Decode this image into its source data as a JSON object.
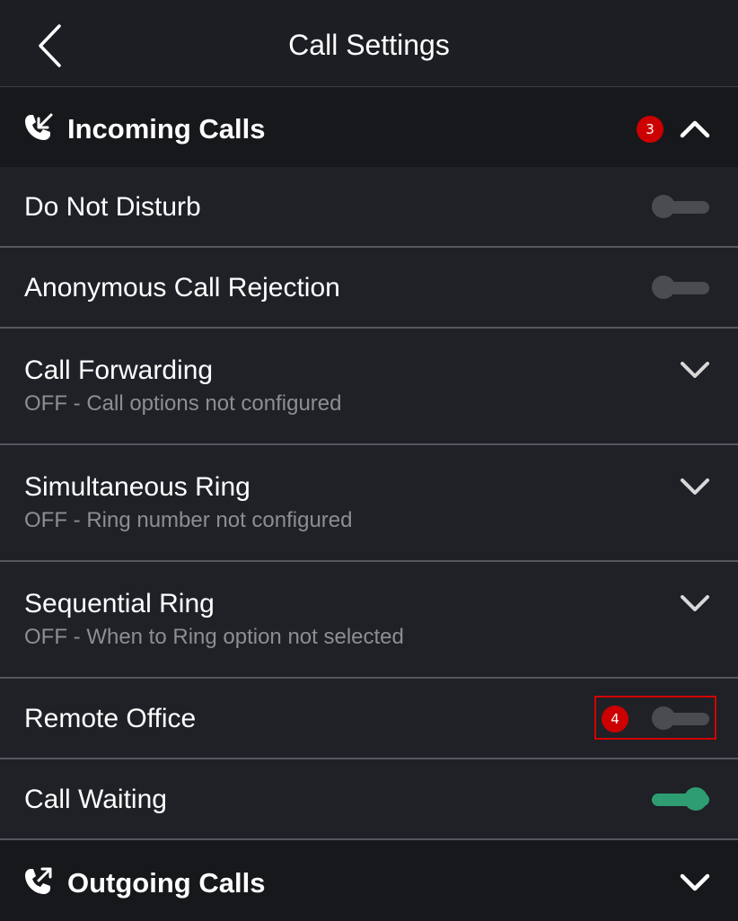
{
  "header": {
    "title": "Call Settings",
    "back_icon": "chevron-left-icon"
  },
  "incoming": {
    "title": "Incoming Calls",
    "icon": "incoming-call-icon",
    "badge": "3",
    "expanded": true
  },
  "rows": {
    "dnd": {
      "title": "Do Not Disturb",
      "toggle": false
    },
    "anon": {
      "title": "Anonymous Call Rejection",
      "toggle": false
    },
    "forwarding": {
      "title": "Call Forwarding",
      "subtitle": "OFF - Call options not configured"
    },
    "simring": {
      "title": "Simultaneous Ring",
      "subtitle": "OFF - Ring number not configured"
    },
    "seqring": {
      "title": "Sequential Ring",
      "subtitle": "OFF - When to Ring option not selected"
    },
    "remote": {
      "title": "Remote Office",
      "toggle": false,
      "badge": "4"
    },
    "waiting": {
      "title": "Call Waiting",
      "toggle": true
    }
  },
  "outgoing": {
    "title": "Outgoing Calls",
    "icon": "outgoing-call-icon",
    "expanded": false
  },
  "colors": {
    "background": "#1b1d22",
    "toggle_on": "#2e9e72",
    "toggle_off": "#4a4c52",
    "badge": "#cc0000",
    "highlight": "#d40000"
  }
}
